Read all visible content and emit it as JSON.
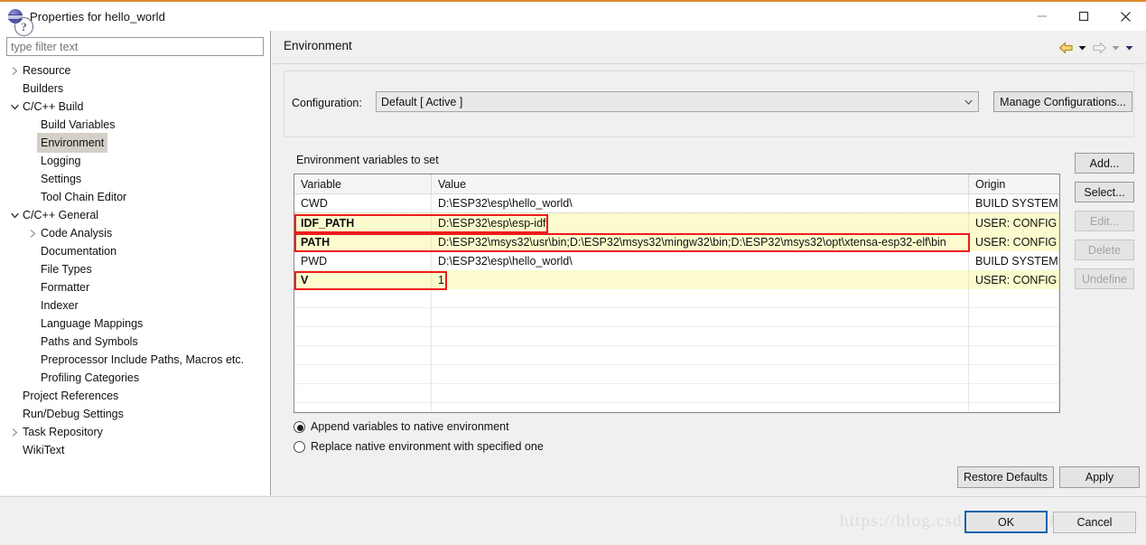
{
  "window": {
    "title": "Properties for hello_world",
    "icon": "eclipse-globe-icon",
    "minimize_label": "Minimize",
    "maximize_label": "Maximize",
    "close_label": "Close"
  },
  "sidebar": {
    "filter_placeholder": "type filter text",
    "filter_value": "",
    "items": [
      {
        "label": "Resource",
        "indent": 0,
        "twisty": "collapsed",
        "selected": false
      },
      {
        "label": "Builders",
        "indent": 0,
        "twisty": "none",
        "selected": false
      },
      {
        "label": "C/C++ Build",
        "indent": 0,
        "twisty": "expanded",
        "selected": false
      },
      {
        "label": "Build Variables",
        "indent": 1,
        "twisty": "none",
        "selected": false
      },
      {
        "label": "Environment",
        "indent": 1,
        "twisty": "none",
        "selected": true
      },
      {
        "label": "Logging",
        "indent": 1,
        "twisty": "none",
        "selected": false
      },
      {
        "label": "Settings",
        "indent": 1,
        "twisty": "none",
        "selected": false
      },
      {
        "label": "Tool Chain Editor",
        "indent": 1,
        "twisty": "none",
        "selected": false
      },
      {
        "label": "C/C++ General",
        "indent": 0,
        "twisty": "expanded",
        "selected": false
      },
      {
        "label": "Code Analysis",
        "indent": 1,
        "twisty": "collapsed",
        "selected": false
      },
      {
        "label": "Documentation",
        "indent": 1,
        "twisty": "none",
        "selected": false
      },
      {
        "label": "File Types",
        "indent": 1,
        "twisty": "none",
        "selected": false
      },
      {
        "label": "Formatter",
        "indent": 1,
        "twisty": "none",
        "selected": false
      },
      {
        "label": "Indexer",
        "indent": 1,
        "twisty": "none",
        "selected": false
      },
      {
        "label": "Language Mappings",
        "indent": 1,
        "twisty": "none",
        "selected": false
      },
      {
        "label": "Paths and Symbols",
        "indent": 1,
        "twisty": "none",
        "selected": false
      },
      {
        "label": "Preprocessor Include Paths, Macros etc.",
        "indent": 1,
        "twisty": "none",
        "selected": false
      },
      {
        "label": "Profiling Categories",
        "indent": 1,
        "twisty": "none",
        "selected": false
      },
      {
        "label": "Project References",
        "indent": 0,
        "twisty": "none",
        "selected": false
      },
      {
        "label": "Run/Debug Settings",
        "indent": 0,
        "twisty": "none",
        "selected": false
      },
      {
        "label": "Task Repository",
        "indent": 0,
        "twisty": "collapsed",
        "selected": false
      },
      {
        "label": "WikiText",
        "indent": 0,
        "twisty": "none",
        "selected": false
      }
    ]
  },
  "page": {
    "title": "Environment",
    "nav": {
      "back_icon": "back-arrow-icon",
      "back_menu_icon": "caret-down-icon",
      "forward_icon": "forward-arrow-icon",
      "forward_menu_icon": "caret-down-icon",
      "overflow_menu_icon": "caret-down-icon"
    },
    "configuration": {
      "label": "Configuration:",
      "selected": "Default  [ Active ]",
      "dropdown_icon": "chevron-down-icon",
      "manage_button": "Manage Configurations..."
    },
    "env_caption": "Environment variables to set",
    "table": {
      "columns": [
        "Variable",
        "Value",
        "Origin"
      ],
      "rows": [
        {
          "variable": "CWD",
          "value": "D:\\ESP32\\esp\\hello_world\\",
          "origin": "BUILD SYSTEM",
          "highlight": false
        },
        {
          "variable": "IDF_PATH",
          "value": "D:\\ESP32\\esp\\esp-idf",
          "origin": "USER: CONFIG",
          "highlight": true
        },
        {
          "variable": "PATH",
          "value": "D:\\ESP32\\msys32\\usr\\bin;D:\\ESP32\\msys32\\mingw32\\bin;D:\\ESP32\\msys32\\opt\\xtensa-esp32-elf\\bin",
          "origin": "USER: CONFIG",
          "highlight": true
        },
        {
          "variable": "PWD",
          "value": "D:\\ESP32\\esp\\hello_world\\",
          "origin": "BUILD SYSTEM",
          "highlight": false
        },
        {
          "variable": "V",
          "value": "1",
          "origin": "USER: CONFIG",
          "highlight": true
        }
      ],
      "empty_row_count": 7
    },
    "side_buttons": [
      {
        "label": "Add...",
        "enabled": true
      },
      {
        "label": "Select...",
        "enabled": true
      },
      {
        "label": "Edit...",
        "enabled": false
      },
      {
        "label": "Delete",
        "enabled": false
      },
      {
        "label": "Undefine",
        "enabled": false
      }
    ],
    "radios": [
      {
        "label": "Append variables to native environment",
        "checked": true
      },
      {
        "label": "Replace native environment with specified one",
        "checked": false
      }
    ],
    "restore_defaults": "Restore Defaults",
    "apply": "Apply"
  },
  "footer": {
    "help_icon": "question-mark-icon",
    "help_glyph": "?",
    "ok": "OK",
    "cancel": "Cancel",
    "watermark": "https://blog.csdn.net/Andy001847"
  },
  "colors": {
    "accent_top_border": "#e08b2d",
    "highlight_row": "#fbfbcd",
    "annotation_red": "#ee1c1c",
    "focus_blue": "#0a64ad",
    "selection_gray": "#d4d0c8"
  }
}
